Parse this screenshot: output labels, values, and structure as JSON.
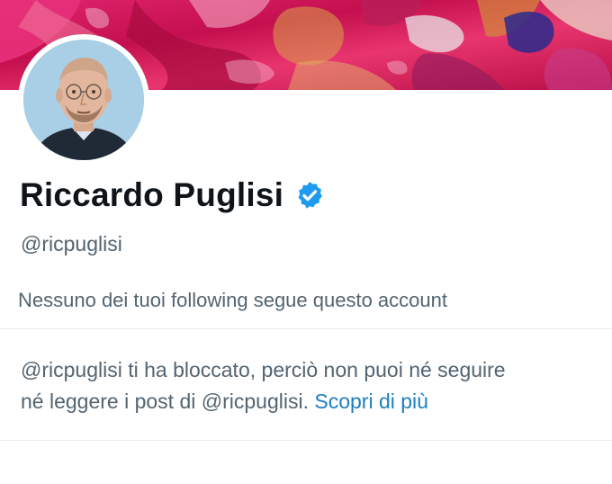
{
  "profile": {
    "name": "Riccardo Puglisi",
    "handle": "@ricpuglisi",
    "verified": true,
    "following_note": "Nessuno dei tuoi following segue questo account"
  },
  "blocked_notice": {
    "text_line1": "@ricpuglisi ti ha bloccato, perciò non puoi né seguire",
    "text_line2": "né leggere i post di @ricpuglisi.",
    "link_label": "Scopri di più"
  },
  "colors": {
    "verified_badge": "#1d9bf0",
    "link": "#1d7fbf",
    "secondary_text": "#536471",
    "primary_text": "#0f1419"
  },
  "icons": {
    "verified": "verified-badge-icon"
  }
}
